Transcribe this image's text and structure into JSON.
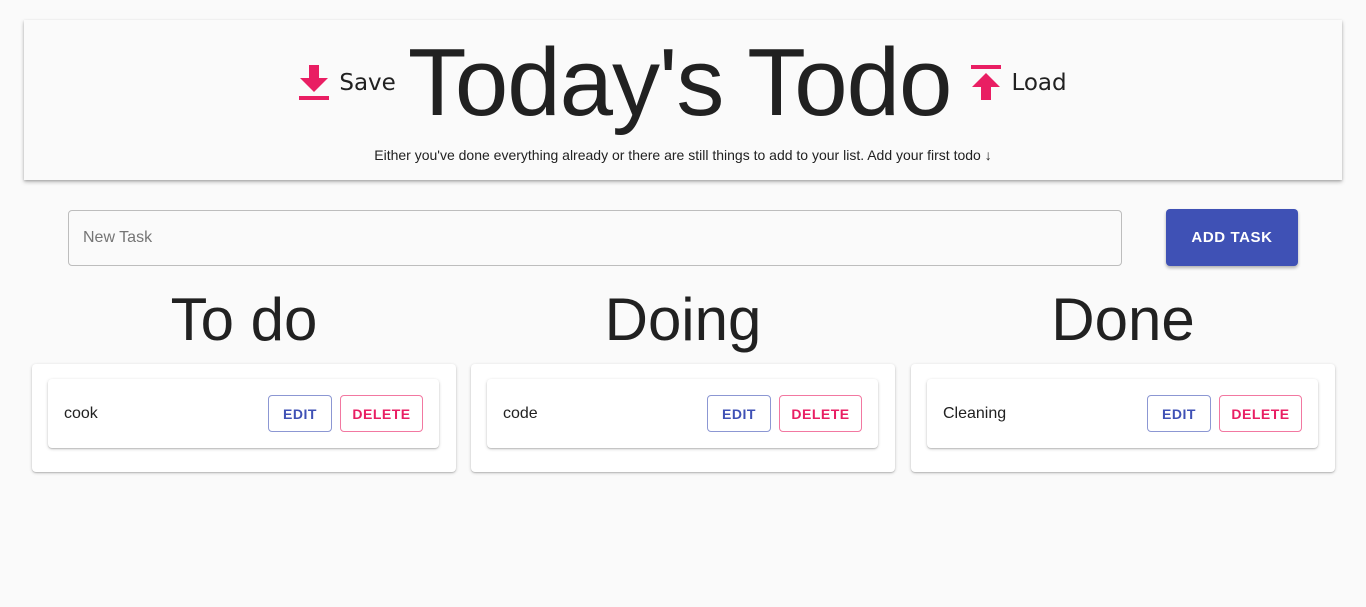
{
  "header": {
    "title": "Today's Todo",
    "subtitle": "Either you've done everything already or there are still things to add to your list. Add your first todo ↓",
    "save_label": "Save",
    "load_label": "Load",
    "save_icon": "download-icon",
    "load_icon": "upload-icon"
  },
  "new_task": {
    "placeholder": "New Task",
    "value": "",
    "add_label": "ADD TASK"
  },
  "columns": [
    {
      "title": "To do",
      "tasks": [
        {
          "name": "cook",
          "edit_label": "EDIT",
          "delete_label": "DELETE"
        }
      ]
    },
    {
      "title": "Doing",
      "tasks": [
        {
          "name": "code",
          "edit_label": "EDIT",
          "delete_label": "DELETE"
        }
      ]
    },
    {
      "title": "Done",
      "tasks": [
        {
          "name": "Cleaning",
          "edit_label": "EDIT",
          "delete_label": "DELETE"
        }
      ]
    }
  ],
  "colors": {
    "primary": "#3f51b5",
    "secondary": "#e91e63",
    "background": "#fafafa",
    "text": "#212121"
  }
}
